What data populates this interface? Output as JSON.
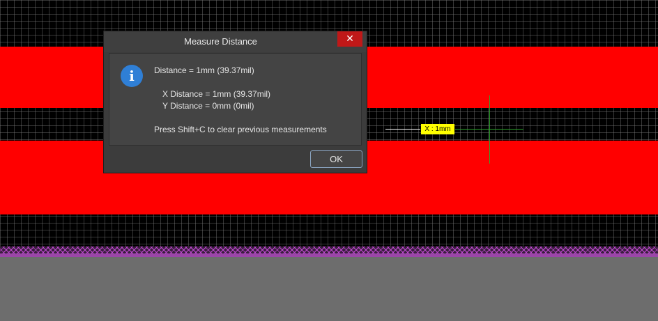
{
  "dialog": {
    "title": "Measure Distance",
    "close_label": "✕",
    "distance": "Distance = 1mm (39.37mil)",
    "x_distance": "X Distance = 1mm (39.37mil)",
    "y_distance": "Y Distance = 0mm (0mil)",
    "hint": "Press Shift+C to clear previous measurements",
    "ok_label": "OK",
    "icon": "info-icon"
  },
  "canvas": {
    "measure_label": "X : 1mm",
    "colors": {
      "trace": "#ff0000",
      "grid": "#787878",
      "measure_label_bg": "#ffff00",
      "cursor": "#2fa52f",
      "board_edge": "#9b46a8"
    }
  }
}
